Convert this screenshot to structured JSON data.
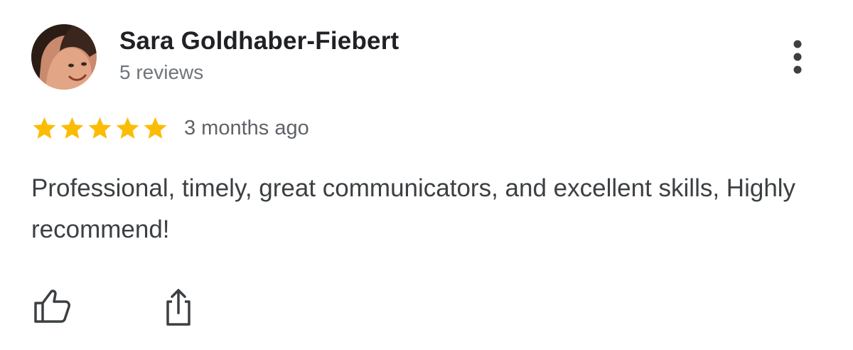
{
  "review": {
    "reviewer": {
      "name": "Sara Goldhaber-Fiebert",
      "meta": "5 reviews"
    },
    "rating": 5,
    "rating_max": 5,
    "timestamp": "3 months ago",
    "text": "Professional, timely, great communicators, and excellent skills, Highly recommend!"
  },
  "icons": {
    "more": "more-vert-icon",
    "star": "star-icon",
    "like": "thumb-up-icon",
    "share": "share-icon"
  },
  "colors": {
    "star": "#fbbc04",
    "name": "#202124",
    "secondary": "#70757a",
    "body": "#3c4043",
    "icon": "#3c4043"
  }
}
